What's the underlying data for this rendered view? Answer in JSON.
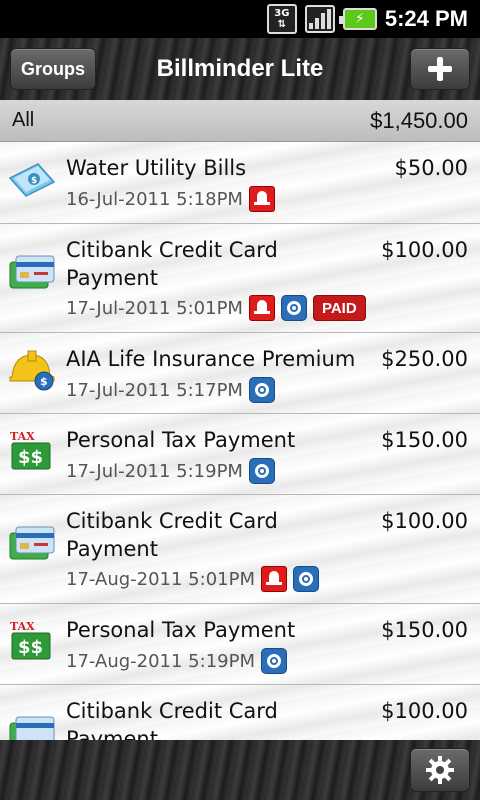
{
  "status_bar": {
    "network": "3G",
    "time": "5:24 PM"
  },
  "header": {
    "groups_label": "Groups",
    "title": "Billminder Lite",
    "add_icon": "plus-icon"
  },
  "filter": {
    "label": "All",
    "total": "$1,450.00"
  },
  "bills": [
    {
      "title": "Water Utility Bills",
      "amount": "$50.00",
      "date": "16-Jul-2011 5:18PM",
      "icon": "water-bill-icon",
      "alarm": true,
      "repeat": false,
      "paid": false
    },
    {
      "title": "Citibank Credit Card Payment",
      "amount": "$100.00",
      "date": "17-Jul-2011 5:01PM",
      "icon": "credit-card-icon",
      "alarm": true,
      "repeat": true,
      "paid": true,
      "paid_label": "PAID"
    },
    {
      "title": "AIA Life Insurance Premium",
      "amount": "$250.00",
      "date": "17-Jul-2011 5:17PM",
      "icon": "insurance-icon",
      "alarm": false,
      "repeat": true,
      "paid": false
    },
    {
      "title": "Personal Tax Payment",
      "amount": "$150.00",
      "date": "17-Jul-2011 5:19PM",
      "icon": "tax-icon",
      "alarm": false,
      "repeat": true,
      "paid": false
    },
    {
      "title": "Citibank Credit Card Payment",
      "amount": "$100.00",
      "date": "17-Aug-2011 5:01PM",
      "icon": "credit-card-icon",
      "alarm": true,
      "repeat": true,
      "paid": false
    },
    {
      "title": "Personal Tax Payment",
      "amount": "$150.00",
      "date": "17-Aug-2011 5:19PM",
      "icon": "tax-icon",
      "alarm": false,
      "repeat": true,
      "paid": false
    },
    {
      "title": "Citibank Credit Card Payment",
      "amount": "$100.00",
      "date": "",
      "icon": "credit-card-icon",
      "alarm": false,
      "repeat": false,
      "paid": false
    }
  ],
  "footer": {
    "settings_icon": "gear-icon"
  },
  "colors": {
    "alarm": "#e01b1b",
    "repeat": "#2a6db8",
    "paid": "#c41a1a"
  }
}
